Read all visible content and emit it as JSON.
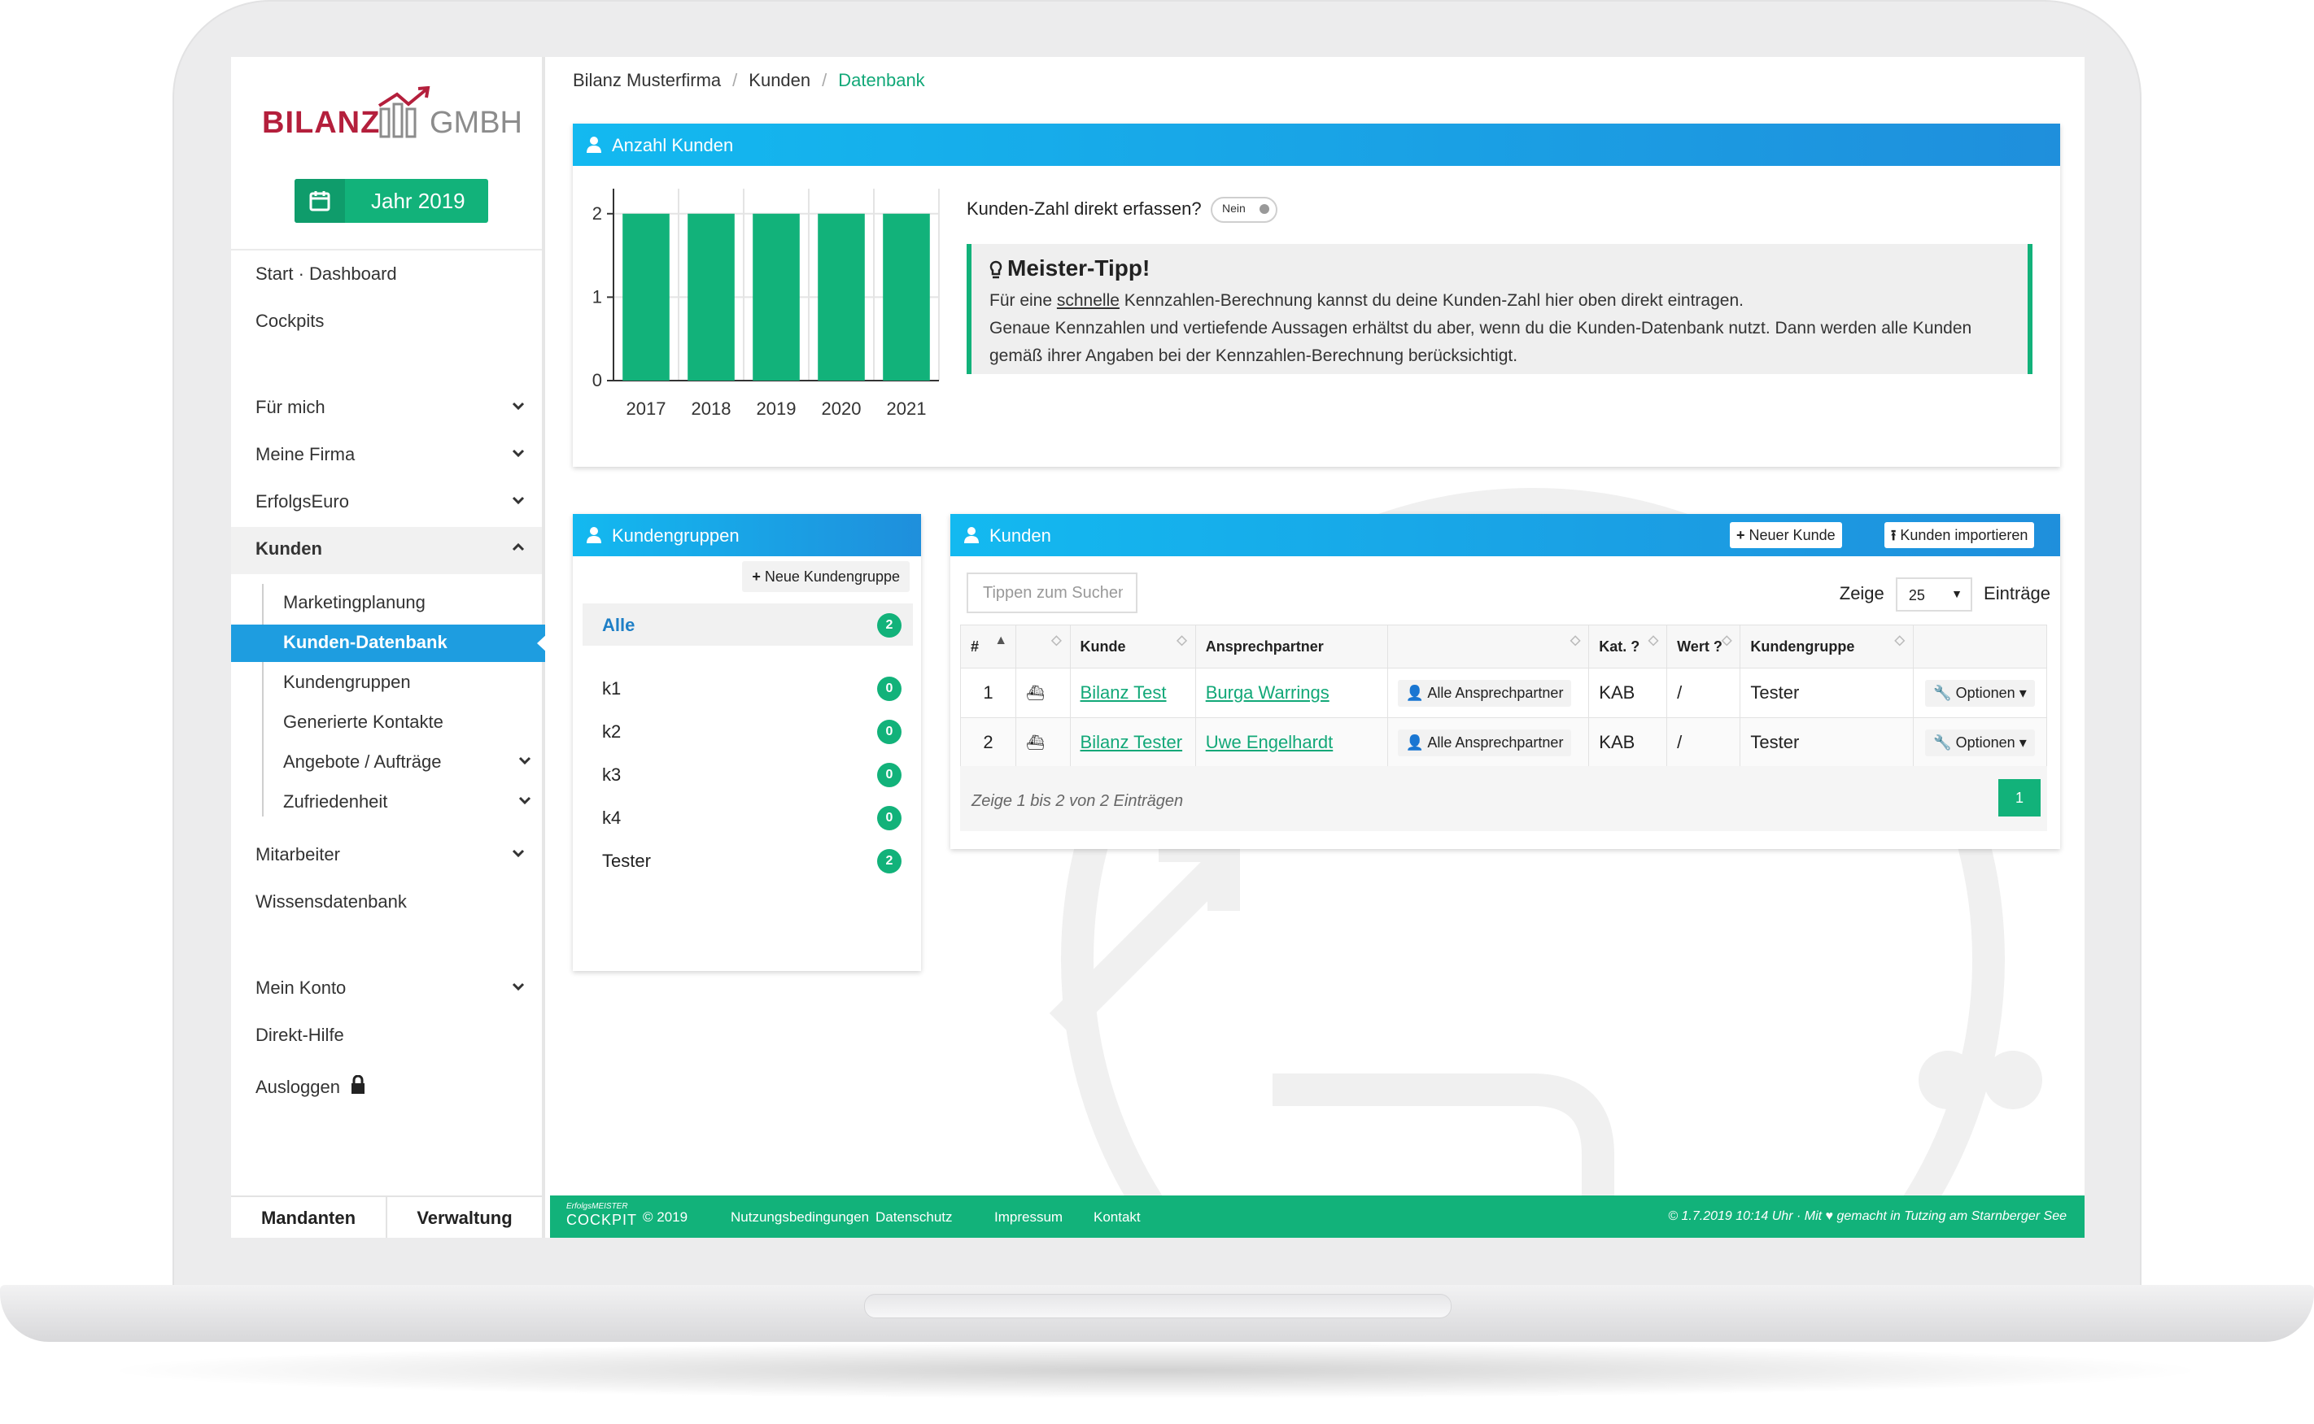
{
  "logo": {
    "word1": "BILANZ",
    "word2": "GMBH"
  },
  "year_button": {
    "label": "Jahr 2019",
    "icon": "calendar-icon"
  },
  "sidebar": {
    "items": [
      {
        "label": "Start · Dashboard"
      },
      {
        "label": "Cockpits"
      },
      {
        "label": "Für mich",
        "icon": "chevron-down-icon"
      },
      {
        "label": "Meine Firma",
        "icon": "chevron-down-icon"
      },
      {
        "label": "ErfolgsEuro",
        "icon": "chevron-down-icon"
      },
      {
        "label": "Kunden",
        "icon": "chevron-up-icon",
        "expanded": true
      },
      {
        "label": "Mitarbeiter",
        "icon": "chevron-down-icon"
      },
      {
        "label": "Wissensdatenbank"
      },
      {
        "label": "Mein Konto",
        "icon": "chevron-down-icon"
      },
      {
        "label": "Direkt-Hilfe"
      },
      {
        "label": "Ausloggen",
        "icon": "lock-icon"
      }
    ],
    "subitems": [
      {
        "label": "Marketingplanung"
      },
      {
        "label": "Kunden-Datenbank",
        "active": true
      },
      {
        "label": "Kundengruppen"
      },
      {
        "label": "Generierte Kontakte"
      },
      {
        "label": "Angebote / Aufträge",
        "icon": "chevron-down-icon"
      },
      {
        "label": "Zufriedenheit",
        "icon": "chevron-down-icon"
      }
    ],
    "bottom": {
      "left": "Mandanten",
      "right": "Verwaltung"
    }
  },
  "breadcrumb": [
    "Bilanz Musterfirma",
    "Kunden",
    "Datenbank"
  ],
  "count_panel": {
    "title": "Anzahl Kunden",
    "question": "Kunden-Zahl direkt erfassen?",
    "toggle": "Nein",
    "tip": {
      "heading": "Meister-Tipp!",
      "line1_pre": "Für eine ",
      "line1_link": "schnelle",
      "line1_post": " Kennzahlen-Berechnung kannst du deine Kunden-Zahl hier oben direkt eintragen.",
      "line2": "Genaue Kennzahlen und vertiefende Aussagen erhältst du aber, wenn du die Kunden-Datenbank nutzt. Dann werden alle Kunden",
      "line3": "gemäß ihrer Angaben bei der Kennzahlen-Berechnung berücksichtigt."
    }
  },
  "chart_data": {
    "type": "bar",
    "categories": [
      "2017",
      "2018",
      "2019",
      "2020",
      "2021"
    ],
    "values": [
      2,
      2,
      2,
      2,
      2
    ],
    "yticks": [
      "0",
      "1",
      "2"
    ],
    "ylim": [
      0,
      2.3
    ],
    "grid": true,
    "color": "#12b27a"
  },
  "groups_panel": {
    "title": "Kundengruppen",
    "new_button": "Neue Kundengruppe",
    "rows": [
      {
        "name": "Alle",
        "count": "2"
      },
      {
        "name": "k1",
        "count": "0"
      },
      {
        "name": "k2",
        "count": "0"
      },
      {
        "name": "k3",
        "count": "0"
      },
      {
        "name": "k4",
        "count": "0"
      },
      {
        "name": "Tester",
        "count": "2"
      }
    ]
  },
  "customers_panel": {
    "title": "Kunden",
    "new_button": "Neuer Kunde",
    "import_button": "Kunden importieren",
    "search_placeholder": "Tippen zum Suchen",
    "show_label": "Zeige",
    "show_value": "25",
    "entries_label": "Einträge",
    "columns": [
      "#",
      "",
      "Kunde",
      "Ansprechpartner",
      "",
      "Kat.",
      "Wert",
      "Kundengruppe",
      ""
    ],
    "rows": [
      {
        "num": "1",
        "kunde": "Bilanz Test",
        "ansprech": "Burga Warrings",
        "all_contacts": "Alle Ansprechpartner",
        "kat": "KAB",
        "wert": "/",
        "gruppe": "Tester",
        "options": "Optionen"
      },
      {
        "num": "2",
        "kunde": "Bilanz Tester",
        "ansprech": "Uwe Engelhardt",
        "all_contacts": "Alle Ansprechpartner",
        "kat": "KAB",
        "wert": "/",
        "gruppe": "Tester",
        "options": "Optionen"
      }
    ],
    "info": "Zeige 1 bis 2 von 2 Einträgen",
    "page": "1"
  },
  "footer": {
    "brand_small": "ErfolgsMEISTER",
    "brand_big": "COCKPIT",
    "copyright": "© 2019",
    "links": [
      "Nutzungsbedingungen",
      "Datenschutz",
      "Impressum",
      "Kontakt"
    ],
    "right_pre": "© 1.7.2019 10:14 Uhr · Mit",
    "right_post": "gemacht in Tutzing am Starnberger See"
  }
}
